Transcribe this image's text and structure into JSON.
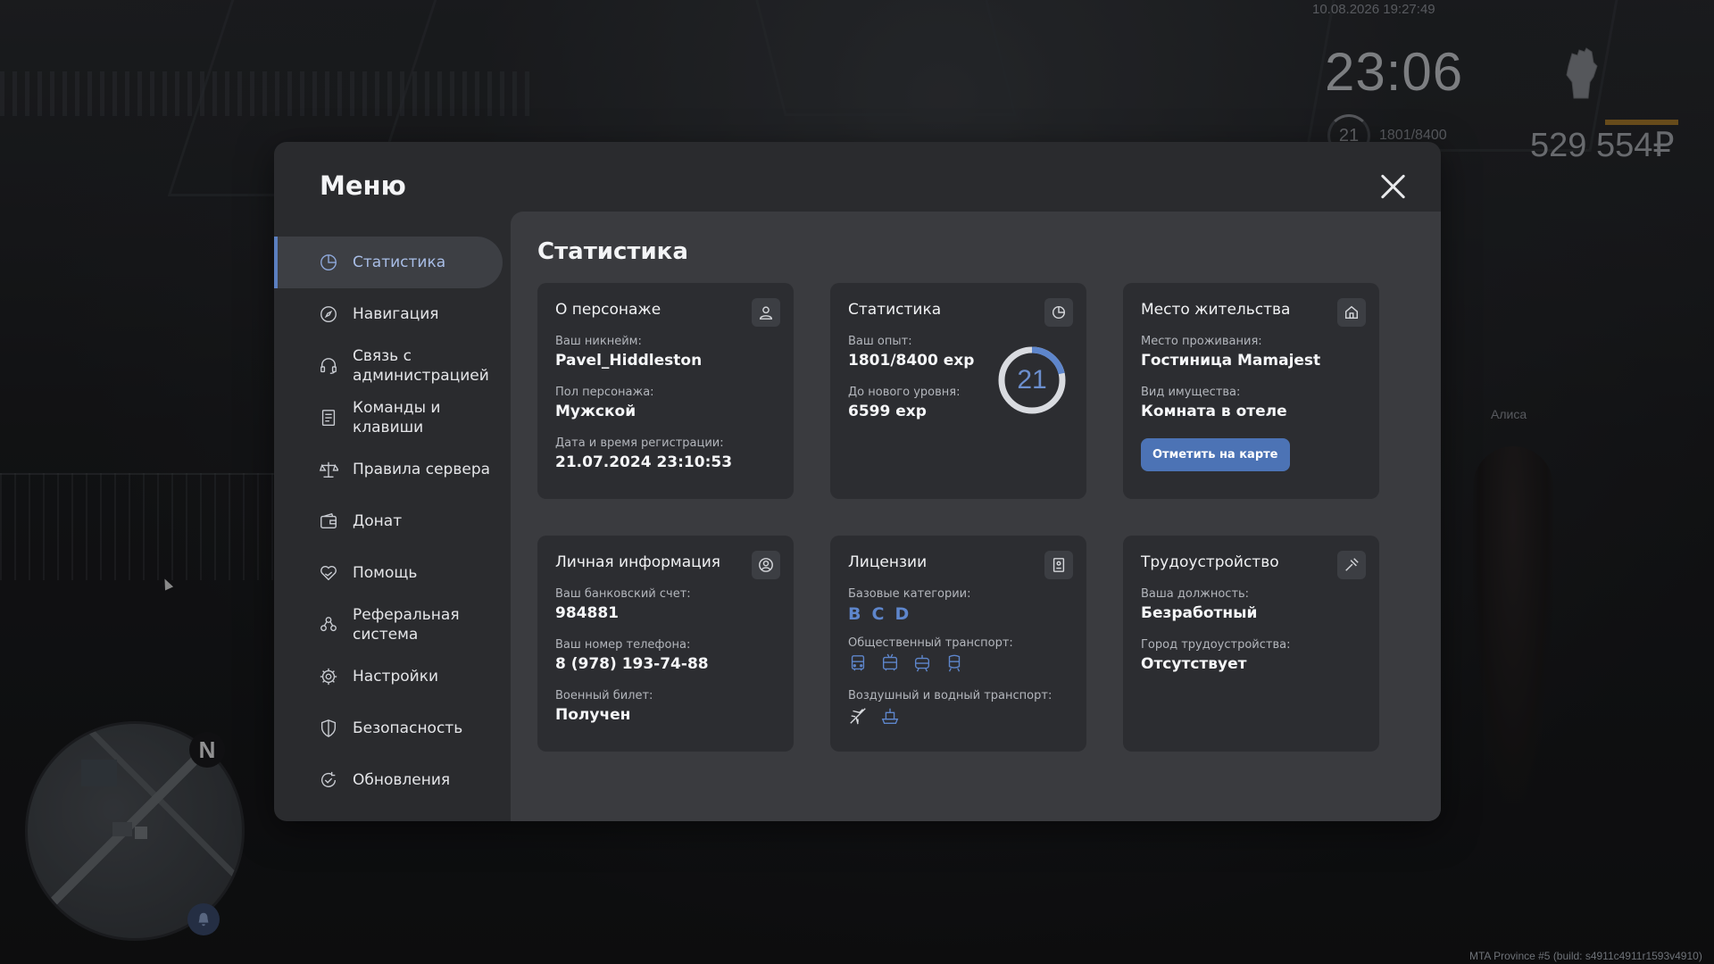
{
  "hud": {
    "datetime": "10.08.2026 19:27:49",
    "clock": "23:06",
    "level": "21",
    "exp": "1801/8400",
    "money": "529 554₽",
    "player_name": "Алиса",
    "build": "MTA Province #5 (build: s4911c4911r1593v4910)",
    "compass": "N"
  },
  "menu": {
    "title": "Меню",
    "sidebar": [
      {
        "label": "Статистика",
        "icon": "pie-chart-icon",
        "active": true
      },
      {
        "label": "Навигация",
        "icon": "compass-icon"
      },
      {
        "label": "Связь с администрацией",
        "icon": "headset-icon"
      },
      {
        "label": "Команды и клавиши",
        "icon": "document-icon"
      },
      {
        "label": "Правила сервера",
        "icon": "scales-icon"
      },
      {
        "label": "Донат",
        "icon": "wallet-icon"
      },
      {
        "label": "Помощь",
        "icon": "heart-hand-icon"
      },
      {
        "label": "Реферальная система",
        "icon": "people-icon"
      },
      {
        "label": "Настройки",
        "icon": "gear-icon"
      },
      {
        "label": "Безопасность",
        "icon": "shield-icon"
      },
      {
        "label": "Обновления",
        "icon": "refresh-check-icon"
      }
    ]
  },
  "content": {
    "title": "Статистика",
    "character": {
      "title": "О персонаже",
      "nick_label": "Ваш никнейм:",
      "nick": "Pavel_Hiddleston",
      "gender_label": "Пол персонажа:",
      "gender": "Мужской",
      "reg_label": "Дата и время регистрации:",
      "reg": "21.07.2024 23:10:53"
    },
    "stats": {
      "title": "Статистика",
      "exp_label": "Ваш опыт:",
      "exp": "1801/8400 exp",
      "next_label": "До нового уровня:",
      "next": "6599 exp",
      "level": "21",
      "progress": 0.214,
      "ring_color": "#5e86cc"
    },
    "residence": {
      "title": "Место жительства",
      "place_label": "Место проживания:",
      "place": "Гостиница Mamajest",
      "property_label": "Вид имущества:",
      "property": "Комната в отеле",
      "button": "Отметить на карте"
    },
    "personal": {
      "title": "Личная информация",
      "bank_label": "Ваш банковский счет:",
      "bank": "984881",
      "phone_label": "Ваш номер телефона:",
      "phone": "8 (978) 193-74-88",
      "military_label": "Военный билет:",
      "military": "Получен"
    },
    "licenses": {
      "title": "Лицензии",
      "base_label": "Базовые категории:",
      "categories": [
        "B",
        "C",
        "D"
      ],
      "public_label": "Общественный транспорт:",
      "public_icons": [
        "bus-icon",
        "trolleybus-icon",
        "tram-icon",
        "train-icon"
      ],
      "air_label": "Воздушный и водный транспорт:",
      "air_icons": [
        "plane-icon",
        "boat-icon"
      ]
    },
    "job": {
      "title": "Трудоустройство",
      "position_label": "Ваша должность:",
      "position": "Безработный",
      "city_label": "Город трудоустройства:",
      "city": "Отсутствует"
    }
  },
  "colors": {
    "accent": "#5b7fc0",
    "panel": "#2a2b2e",
    "card": "#2c2d31",
    "content_bg": "#3a3b3f",
    "money_bar": "#a67a2c"
  }
}
